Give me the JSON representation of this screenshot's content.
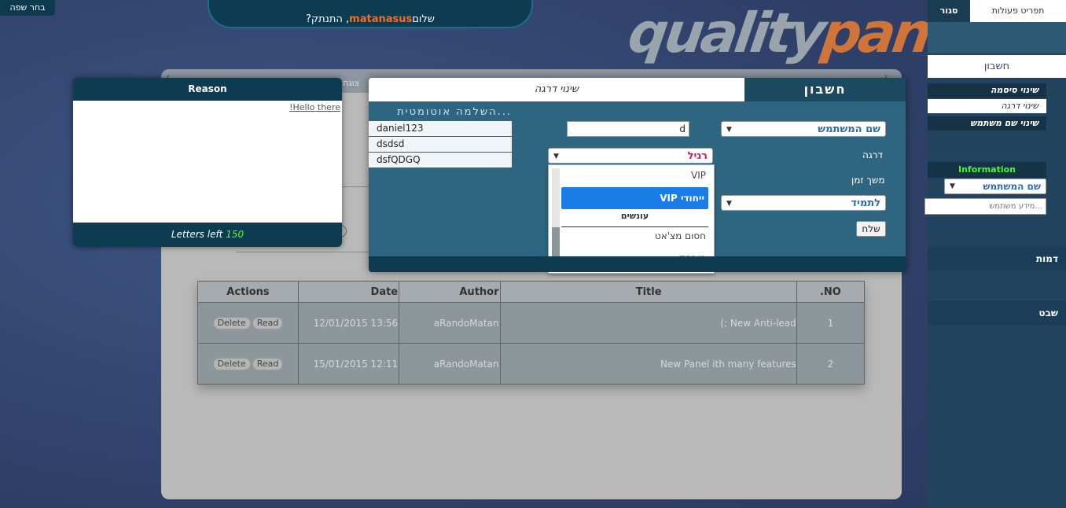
{
  "top": {
    "language_button": "בחר שפה",
    "greeting_prefix": "שלום ",
    "greeting_user": "matanasus",
    "greeting_suffix": ", התנתק?"
  },
  "logo": {
    "part1": "quality",
    "part2": "panel"
  },
  "background_panel": {
    "tab_fragment": "צוגת"
  },
  "news_table": {
    "headers": [
      "Actions",
      "Date",
      "Author",
      "Title",
      ".NO"
    ],
    "rows": [
      {
        "no": "1",
        "title": "(; New Anti-lead",
        "author": "aRandoMatan",
        "date": "12/01/2015 13:56",
        "read": "Read",
        "delete": "Delete"
      },
      {
        "no": "2",
        "title": "New Panel ith many features",
        "author": "aRandoMatan",
        "date": "15/01/2015 12:11",
        "read": "Read",
        "delete": "Delete"
      }
    ]
  },
  "reason_popup": {
    "title": "Reason",
    "text": "!Hello there",
    "letters_left_label": "Letters left",
    "letters_left_count": "150"
  },
  "account_popup": {
    "tab_account": "חשבון",
    "tab_change_rank": "שינוי דרגה",
    "autocomplete_title": "השלמה אוטומטית...",
    "autocomplete_items": [
      "daniel123",
      "dsdsd",
      "dsfQDGQ"
    ],
    "search_type": "שם המשתמש",
    "search_value": "d",
    "rank_label": "דרגה",
    "rank_value": "רגיל",
    "duration_label": "משך זמן",
    "duration_value": "לתמיד",
    "send_button": "שלח",
    "rank_options": {
      "vip": "VIP",
      "vip_special": "VIP ייחודי",
      "punishments_group": "עונשים",
      "chat_block": "חסום מצ'אט",
      "banned": "מורחק"
    }
  },
  "sidebar": {
    "tab_actions": "תפריט פעולות",
    "tab_close": "סגור",
    "account": "חשבון",
    "links": [
      "שינוי סיסמה",
      "שינוי דרגה",
      "שינוי שם משתמש"
    ],
    "info_title": "Information",
    "info_select": "שם המשתמש",
    "info_placeholder": "מידע משתמש...",
    "section_characters": "דמות",
    "section_tribe": "שבט"
  },
  "colors": {
    "accent_orange": "#ff6a1a",
    "dark_teal": "#0d3b4f",
    "select_blue": "#1a7ce6",
    "green_counter": "#4cff2b"
  }
}
